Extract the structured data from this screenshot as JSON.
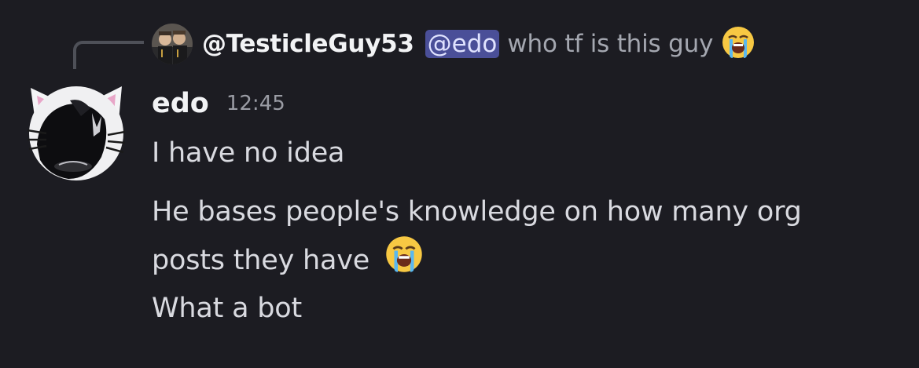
{
  "reply": {
    "author": "@TesticleGuy53",
    "mention": "@edo",
    "text": "who tf is this guy",
    "emoji_icon": "loudly-crying-face-icon"
  },
  "message": {
    "author": "edo",
    "timestamp": "12:45",
    "lines": [
      {
        "text": "I have no idea"
      },
      {
        "text_line1": "He bases people's knowledge on how many org",
        "text_line2": "posts they have",
        "emoji_icon": "loudly-crying-face-icon"
      },
      {
        "text": "What a bot"
      }
    ]
  },
  "colors": {
    "background": "#1c1c22",
    "mention_bg": "#4a4f98",
    "author": "#f2f3f5",
    "message_text": "#d9dae0",
    "muted_text": "#a4a7b0"
  }
}
